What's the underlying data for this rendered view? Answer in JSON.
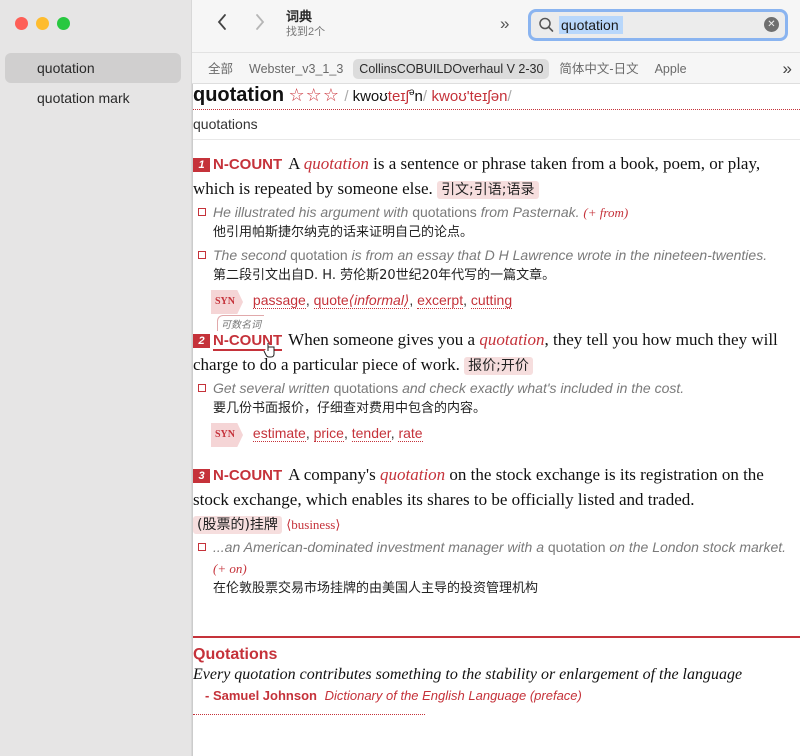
{
  "window": {
    "title": "词典",
    "subtitle": "找到2个"
  },
  "sidebar": {
    "items": [
      {
        "label": "quotation",
        "active": true
      },
      {
        "label": "quotation mark",
        "active": false
      }
    ]
  },
  "toolbar": {
    "back_icon": "chevron-left-icon",
    "forward_icon": "chevron-right-icon",
    "more_label": "»",
    "search": {
      "value": "quotation",
      "placeholder": ""
    }
  },
  "dictionaries": {
    "tabs": [
      {
        "label": "全部",
        "active": false
      },
      {
        "label": "Webster_v3_1_3",
        "active": false
      },
      {
        "label": "CollinsCOBUILDOverhaul V 2-30",
        "active": true
      },
      {
        "label": "简体中文-日文",
        "active": false
      },
      {
        "label": "Apple",
        "active": false
      }
    ],
    "more_label": "»"
  },
  "entry": {
    "headword": "quotation",
    "stars": "☆☆☆",
    "pron_uk_a": "kwoʊ",
    "pron_uk_b": "teɪʃ",
    "pron_uk_c": "ə",
    "pron_uk_d": "n",
    "pron_us": "kwoʊ'teɪʃən",
    "forms": "quotations",
    "senses": [
      {
        "num": "1",
        "pos": "N-COUNT",
        "def_pre": "A ",
        "def_kw": "quotation",
        "def_post": " is a sentence or phrase taken from a book, poem, or play, which is repeated by someone else.",
        "cn": "引文;引语;语录",
        "examples": [
          {
            "en_a": "He illustrated his argument with ",
            "en_b": "quotations",
            "en_c": " from Pasternak.",
            "gram": "(+ from)",
            "cn": "他引用帕斯捷尔纳克的话来证明自己的论点。"
          },
          {
            "en_a": "The second ",
            "en_b": "quotation",
            "en_c": " is from an essay that D H Lawrence wrote in the nineteen-twenties.",
            "gram": "",
            "cn": "第二段引文出自D. H. 劳伦斯20世纪20年代写的一篇文章。"
          }
        ],
        "syn_label": "SYN",
        "syn": [
          "passage",
          "quote",
          "excerpt",
          "cutting"
        ],
        "syn_reg": "⟨informal⟩"
      },
      {
        "num": "2",
        "pos": "N-COUNT",
        "pos_tooltip": "可数名词",
        "def_pre": "When someone gives you a ",
        "def_kw": "quotation",
        "def_post": ", they tell you how much they will charge to do a particular piece of work.",
        "cn": "报价;开价",
        "examples": [
          {
            "en_a": "Get several written ",
            "en_b": "quotations",
            "en_c": " and check exactly what's included in the cost.",
            "gram": "",
            "cn": "要几份书面报价，仔细查对费用中包含的内容。"
          }
        ],
        "syn_label": "SYN",
        "syn": [
          "estimate",
          "price",
          "tender",
          "rate"
        ]
      },
      {
        "num": "3",
        "pos": "N-COUNT",
        "def_pre": "A company's ",
        "def_kw": "quotation",
        "def_post": " on the stock exchange is its registration on the stock exchange, which enables its shares to be officially listed and traded.",
        "cn": "(股票的)挂牌",
        "reg": "⟨business⟩",
        "examples": [
          {
            "en_a": "...an American-dominated investment manager with a ",
            "en_b": "quotation",
            "en_c": " on the London stock market.",
            "gram": "(+ on)",
            "cn": "在伦敦股票交易市场挂牌的由美国人主导的投资管理机构"
          }
        ]
      }
    ],
    "quotations": {
      "title": "Quotations",
      "text": "Every quotation contributes something to the stability or enlargement of the language",
      "author": "- Samuel Johnson",
      "work": "Dictionary of the English Language (preface)"
    }
  },
  "colors": {
    "accent": "#c5323a",
    "cn_highlight": "#f6dede",
    "search_ring": "#8ab4f0"
  }
}
